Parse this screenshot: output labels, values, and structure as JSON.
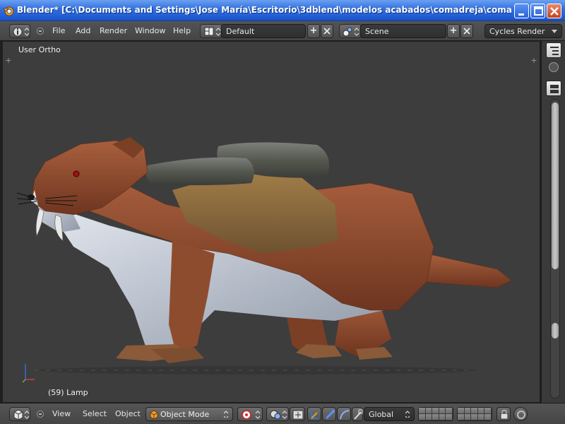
{
  "window": {
    "title": "Blender* [C:\\Documents and Settings\\Jose María\\Escritorio\\3dblend\\modelos acabados\\comadreja\\comadreja ...",
    "buttons": [
      "minimize",
      "maximize",
      "close"
    ]
  },
  "info_header": {
    "menus": [
      "File",
      "Add",
      "Render",
      "Window",
      "Help"
    ],
    "screen_layout": "Default",
    "scene": "Scene",
    "render_engine": "Cycles Render"
  },
  "viewport": {
    "view_label": "User Ortho",
    "object_info": "(59) Lamp",
    "background_color": "#3d3d3d"
  },
  "view3d_header": {
    "menus": [
      "View",
      "Select",
      "Object"
    ],
    "mode": "Object Mode",
    "transform_orientation": "Global"
  },
  "colors": {
    "titlebar": "#2f6fe0",
    "header": "#4a4a4a",
    "fur_brown": "#8b4a2e",
    "belly_white": "#c9cfd8",
    "saddle": "#8a6a3a",
    "log_gray": "#5c5f5a"
  },
  "icons": [
    "blender-logo-icon",
    "minimize-icon",
    "maximize-icon",
    "close-icon",
    "info-editor-icon",
    "screen-layout-icon",
    "scene-icon",
    "add-icon",
    "delete-icon",
    "outliner-icon",
    "properties-icon",
    "view3d-editor-icon",
    "object-mode-icon",
    "pivot-point-icon",
    "viewport-shading-icon",
    "manipulator-icon",
    "translate-icon",
    "rotate-icon",
    "scale-icon",
    "layer-lock-icon",
    "render-preview-icon"
  ]
}
